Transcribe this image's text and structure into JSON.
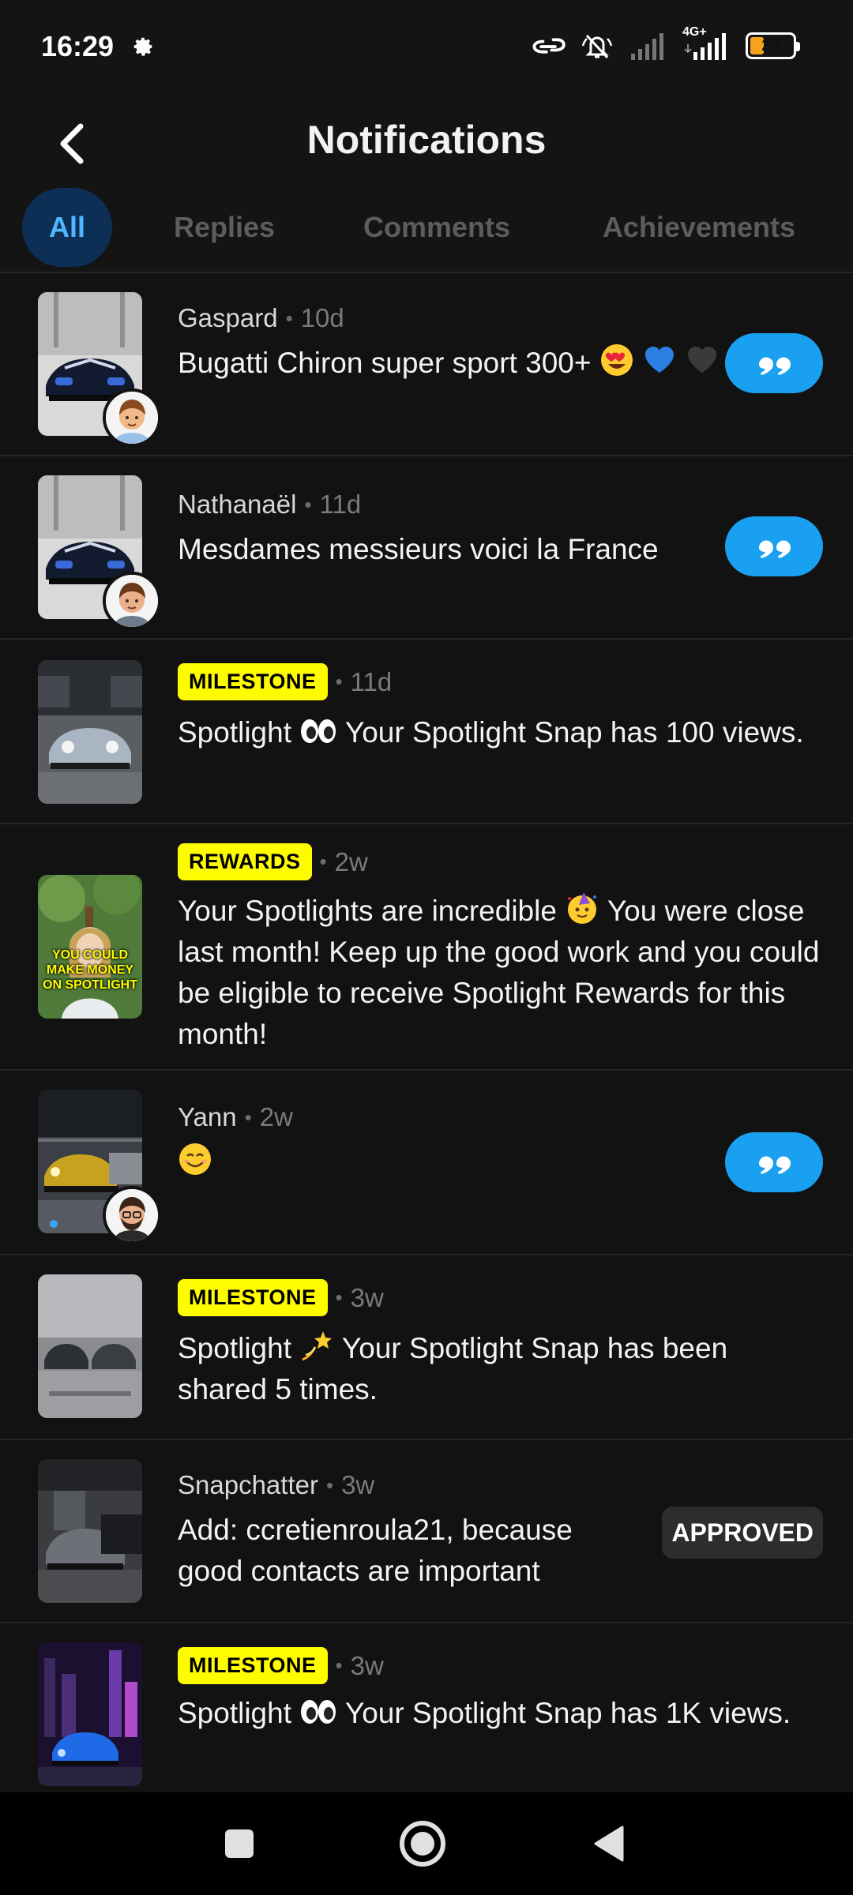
{
  "status_bar": {
    "time": "16:29",
    "network": "4G+",
    "battery_level": "29",
    "battery_fraction": 0.29
  },
  "header": {
    "title": "Notifications"
  },
  "tabs": [
    {
      "label": "All",
      "active": true
    },
    {
      "label": "Replies",
      "active": false
    },
    {
      "label": "Comments",
      "active": false
    },
    {
      "label": "Achievements",
      "active": false
    }
  ],
  "notifications": [
    {
      "type": "reply",
      "sender": "Gaspard",
      "time": "10d",
      "text": "Bugatti Chiron super sport 300+",
      "emojis": [
        "heart-eyes",
        "blue-heart",
        "black-heart"
      ]
    },
    {
      "type": "reply",
      "sender": "Nathanaël",
      "time": "11d",
      "text": "Mesdames messieurs voici la France"
    },
    {
      "type": "milestone",
      "badge": "MILESTONE",
      "time": "11d",
      "text_before": "Spotlight",
      "text_after": "Your Spotlight Snap has 100 views.",
      "emoji": "eyes"
    },
    {
      "type": "rewards",
      "badge": "REWARDS",
      "time": "2w",
      "text_before": "Your Spotlights are incredible",
      "text_after": "You were close last month! Keep up the good work and you could be eligible to receive Spotlight Rewards for this month!",
      "emoji": "party-face",
      "thumb_caption": "YOU COULD MAKE MONEY ON SPOTLIGHT"
    },
    {
      "type": "reply",
      "sender": "Yann",
      "time": "2w",
      "text": "",
      "emojis": [
        "smiling-face"
      ]
    },
    {
      "type": "milestone",
      "badge": "MILESTONE",
      "time": "3w",
      "text_before": "Spotlight",
      "text_after": "Your Spotlight Snap has been shared 5 times.",
      "emoji": "dizzy"
    },
    {
      "type": "friend_request",
      "sender": "Snapchatter",
      "time": "3w",
      "text": "Add: ccretienroula21, because good contacts are important",
      "action_label": "APPROVED"
    },
    {
      "type": "milestone",
      "badge": "MILESTONE",
      "time": "3w",
      "text_before": "Spotlight",
      "text_after": "Your Spotlight Snap has 1K views.",
      "emoji": "eyes"
    }
  ],
  "colors": {
    "background": "#121212",
    "accent_blue": "#1aa0f1",
    "active_tab_bg": "#0d2f55",
    "active_tab_text": "#4fb7ff",
    "badge_yellow": "#fffc00",
    "divider": "#262626"
  }
}
